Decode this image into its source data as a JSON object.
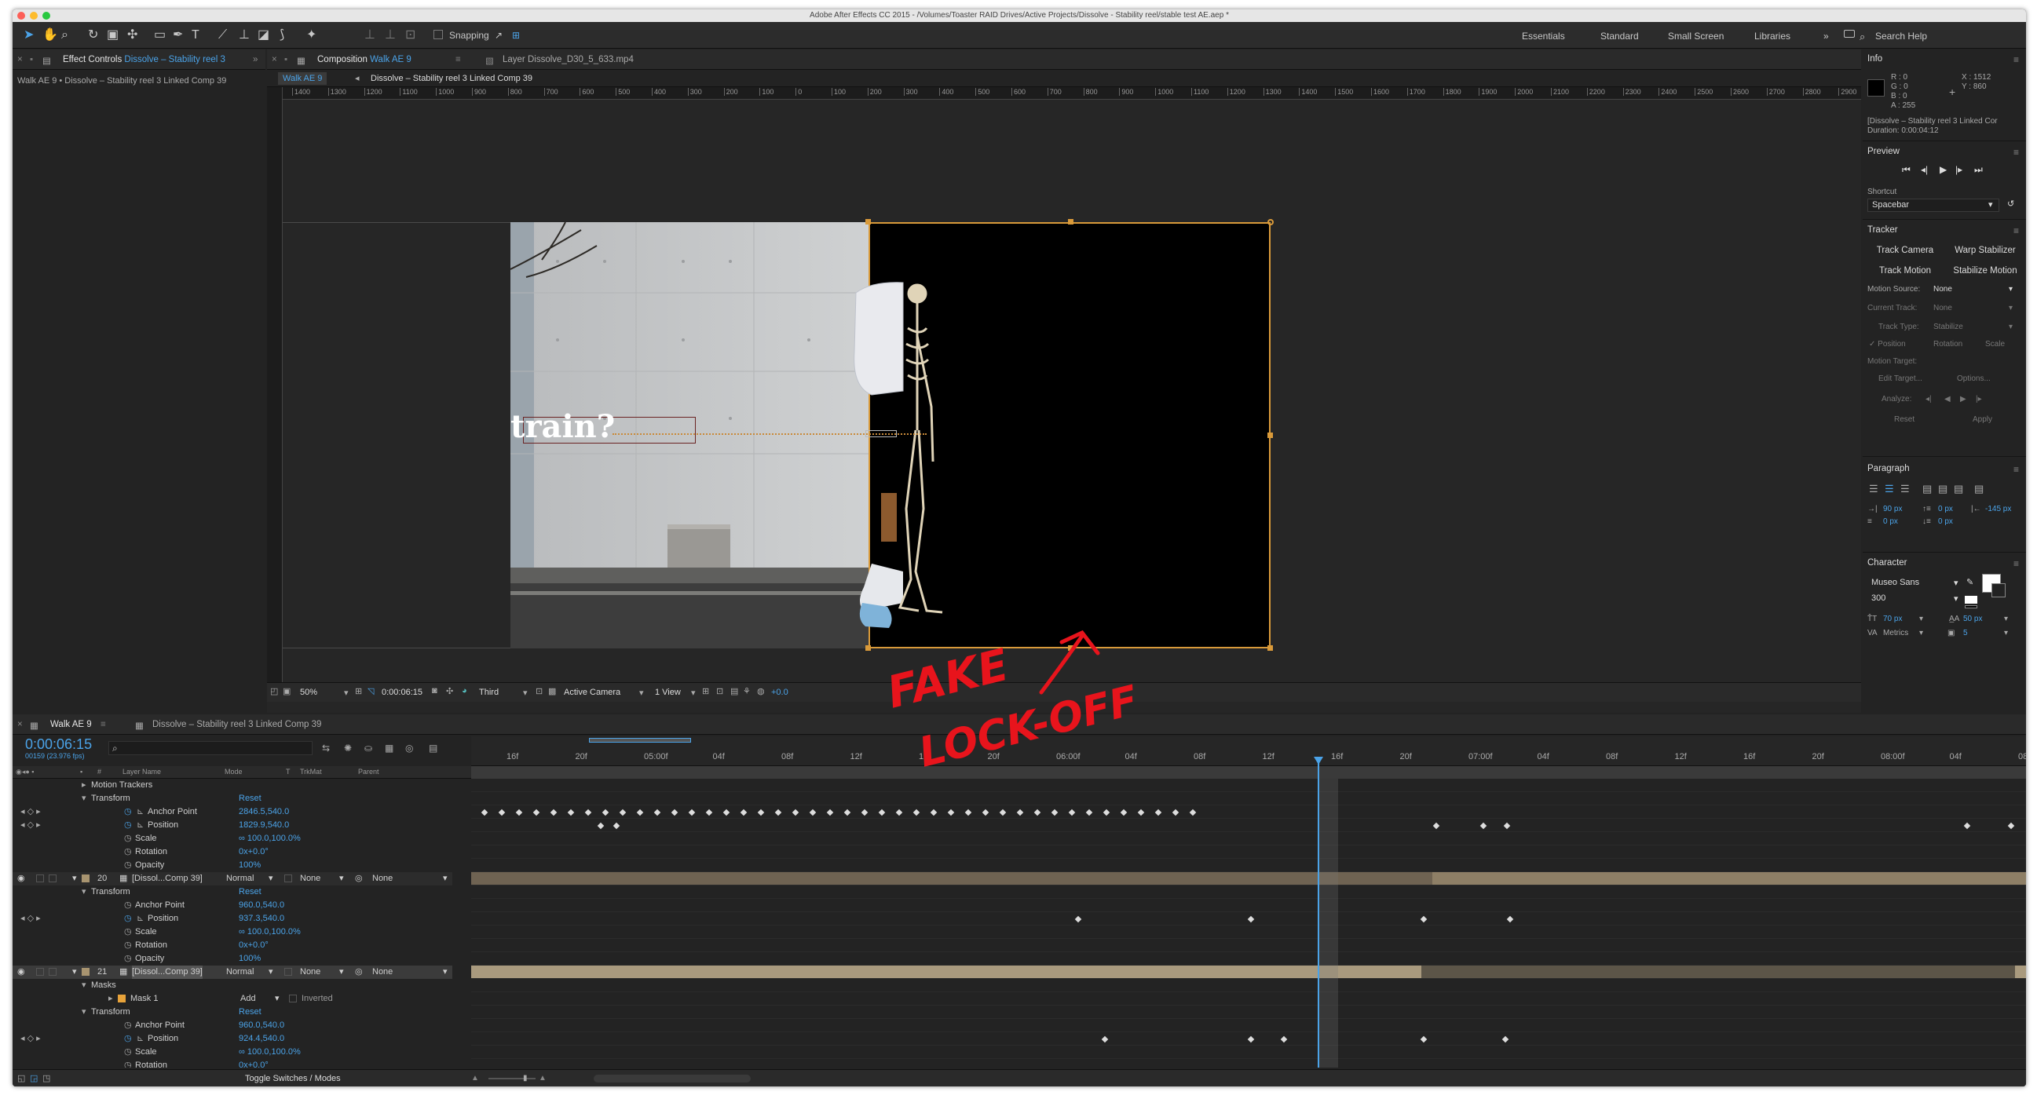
{
  "window_title": "Adobe After Effects CC 2015 - /Volumes/Toaster RAID Drives/Active Projects/Dissolve - Stability reel/stable test AE.aep *",
  "toolbar": {
    "snapping": "Snapping",
    "icons": [
      "selection-tool-icon",
      "hand-tool-icon",
      "zoom-tool-icon",
      "rotation-tool-icon",
      "camera-tool-icon",
      "pan-behind-tool-icon",
      "rectangle-tool-icon",
      "pen-tool-icon",
      "type-tool-icon",
      "brush-tool-icon",
      "clone-stamp-tool-icon",
      "eraser-tool-icon",
      "roto-brush-tool-icon",
      "puppet-pin-tool-icon"
    ]
  },
  "workspaces": [
    "Essentials",
    "Standard",
    "Small Screen",
    "Libraries"
  ],
  "search_help": "Search Help",
  "effect_controls": {
    "tab_label": "Effect Controls",
    "tab_target": "Dissolve – Stability reel 3",
    "path": "Walk AE 9 • Dissolve – Stability reel 3 Linked Comp 39"
  },
  "composition": {
    "tab_label": "Composition",
    "tab_target": "Walk AE 9",
    "layer_tab": "Layer Dissolve_D30_5_633.mp4",
    "crumb_1": "Walk AE 9",
    "crumb_2": "Dissolve – Stability reel 3 Linked Comp 39"
  },
  "ruler": [
    "1400",
    "1300",
    "1200",
    "1100",
    "1000",
    "900",
    "800",
    "700",
    "600",
    "500",
    "400",
    "300",
    "200",
    "100",
    "0",
    "100",
    "200",
    "300",
    "400",
    "500",
    "600",
    "700",
    "800",
    "900",
    "1000",
    "1100",
    "1200",
    "1300",
    "1400",
    "1500",
    "1600",
    "1700",
    "1800",
    "1900",
    "2000",
    "2100",
    "2200",
    "2300",
    "2400",
    "2500",
    "2600",
    "2700",
    "2800",
    "2900"
  ],
  "overlay_text": "train?",
  "viewer_footer": {
    "zoom": "50%",
    "timecode": "0:00:06:15",
    "resolution": "Third",
    "camera": "Active Camera",
    "views": "1 View",
    "exposure": "+0.0"
  },
  "annotation": {
    "line1": "FAKE",
    "line2": "LOCK-OFF",
    "color": "#e8141c"
  },
  "info": {
    "title": "Info",
    "r": "R : 0",
    "g": "G : 0",
    "b": "B : 0",
    "a": "A : 255",
    "x": "X : 1512",
    "y": "Y : 860",
    "layer": "[Dissolve – Stability reel 3 Linked Cor",
    "duration": "Duration: 0:00:04:12"
  },
  "preview": {
    "title": "Preview",
    "shortcut_label": "Shortcut",
    "shortcut_value": "Spacebar"
  },
  "tracker": {
    "title": "Tracker",
    "track_camera": "Track Camera",
    "warp_stabilizer": "Warp Stabilizer",
    "track_motion": "Track Motion",
    "stabilize_motion": "Stabilize Motion",
    "motion_source_label": "Motion Source:",
    "motion_source": "None",
    "current_track_label": "Current Track:",
    "current_track": "None",
    "track_type_label": "Track Type:",
    "track_type": "Stabilize",
    "position": "Position",
    "rotation": "Rotation",
    "scale": "Scale",
    "motion_target": "Motion Target:",
    "edit_target": "Edit Target...",
    "options": "Options...",
    "analyze": "Analyze:",
    "reset": "Reset",
    "apply": "Apply"
  },
  "paragraph": {
    "title": "Paragraph",
    "indent_left": "90 px",
    "space_before": "0 px",
    "indent_right": "-145 px",
    "indent_first": "0 px",
    "space_after": "0 px"
  },
  "character": {
    "title": "Character",
    "font": "Museo Sans",
    "weight": "300",
    "size": "70 px",
    "leading": "50 px",
    "kerning": "Metrics",
    "tracking": "5"
  },
  "timeline": {
    "tab": "Walk AE 9",
    "tab2": "Dissolve – Stability reel 3 Linked Comp 39",
    "timecode": "0:00:06:15",
    "frames": "00159 (23.976 fps)",
    "headers": {
      "num": "#",
      "name": "Layer Name",
      "mode": "Mode",
      "t": "T",
      "trkmat": "TrkMat",
      "parent": "Parent"
    },
    "ticks": [
      "16f",
      "20f",
      "05:00f",
      "04f",
      "08f",
      "12f",
      "16f",
      "20f",
      "06:00f",
      "04f",
      "08f",
      "12f",
      "16f",
      "20f",
      "07:00f",
      "04f",
      "08f",
      "12f",
      "16f",
      "20f",
      "08:00f",
      "04f",
      "08"
    ],
    "rows": [
      {
        "indent": 1,
        "text": "Motion Trackers",
        "tw": true
      },
      {
        "indent": 1,
        "text": "Transform",
        "tw": true,
        "value": "Reset"
      },
      {
        "indent": 2,
        "text": "Anchor Point",
        "value": "2846.5,540.0",
        "sw": true,
        "nav": true
      },
      {
        "indent": 2,
        "text": "Position",
        "value": "1829.9,540.0",
        "sw": true,
        "nav": true
      },
      {
        "indent": 2,
        "text": "Scale",
        "value": "∞ 100.0,100.0%",
        "sw": true
      },
      {
        "indent": 2,
        "text": "Rotation",
        "value": "0x+0.0°",
        "sw": true
      },
      {
        "indent": 2,
        "text": "Opacity",
        "value": "100%",
        "sw": true
      },
      {
        "layer": true,
        "num": "20",
        "text": "[Dissol...Comp 39]",
        "mode": "Normal",
        "trk": "None",
        "parent": "None"
      },
      {
        "indent": 1,
        "text": "Transform",
        "tw": true,
        "value": "Reset"
      },
      {
        "indent": 2,
        "text": "Anchor Point",
        "value": "960.0,540.0",
        "sw": true
      },
      {
        "indent": 2,
        "text": "Position",
        "value": "937.3,540.0",
        "sw": true,
        "nav": true
      },
      {
        "indent": 2,
        "text": "Scale",
        "value": "∞ 100.0,100.0%",
        "sw": true
      },
      {
        "indent": 2,
        "text": "Rotation",
        "value": "0x+0.0°",
        "sw": true
      },
      {
        "indent": 2,
        "text": "Opacity",
        "value": "100%",
        "sw": true
      },
      {
        "layer": true,
        "num": "21",
        "text": "[Dissol...Comp 39]",
        "mode": "Normal",
        "trk": "None",
        "parent": "None",
        "sel": true
      },
      {
        "indent": 1,
        "text": "Masks",
        "tw": true
      },
      {
        "indent": 2,
        "text": "Mask 1",
        "mask": true,
        "mmode": "Add",
        "inverted": "Inverted"
      },
      {
        "indent": 1,
        "text": "Transform",
        "tw": true,
        "value": "Reset"
      },
      {
        "indent": 2,
        "text": "Anchor Point",
        "value": "960.0,540.0",
        "sw": true
      },
      {
        "indent": 2,
        "text": "Position",
        "value": "924.4,540.0",
        "sw": true,
        "nav": true
      },
      {
        "indent": 2,
        "text": "Scale",
        "value": "∞ 100.0,100.0%",
        "sw": true
      },
      {
        "indent": 2,
        "text": "Rotation",
        "value": "0x+0.0°",
        "sw": true
      }
    ],
    "toggle": "Toggle Switches / Modes"
  }
}
